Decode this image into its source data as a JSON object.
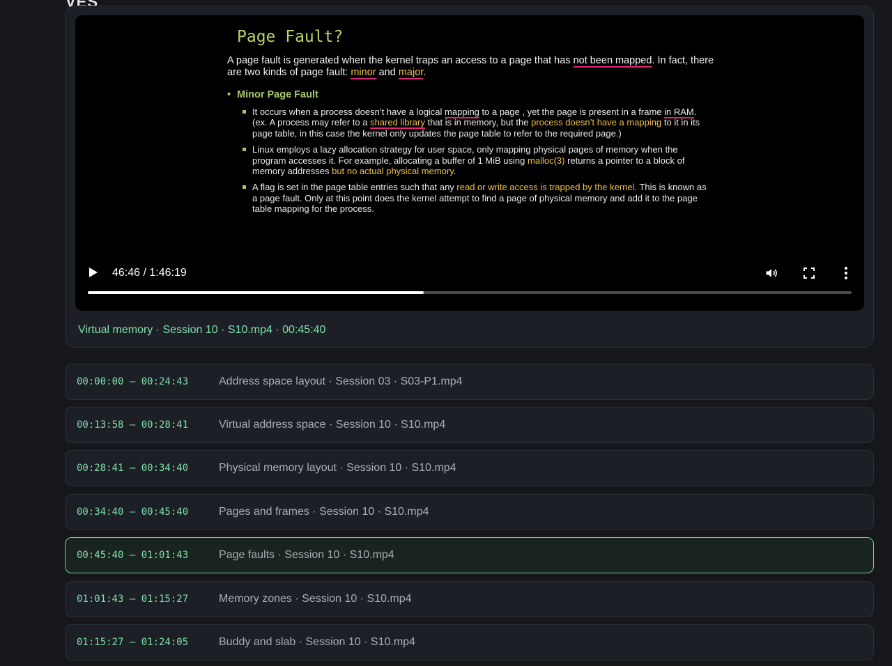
{
  "top_fragment": "VES",
  "video": {
    "slide": {
      "title": "Page Fault?",
      "intro_parts": [
        {
          "text": "A page fault is generated when the kernel traps an access to a page that has ",
          "style": ""
        },
        {
          "text": "not been mapped",
          "style": "underline"
        },
        {
          "text": ". In fact, there are two kinds of page fault: ",
          "style": ""
        },
        {
          "text": "minor",
          "style": "yellow-underline"
        },
        {
          "text": " and ",
          "style": ""
        },
        {
          "text": "major",
          "style": "yellow-underline"
        },
        {
          "text": ".",
          "style": ""
        }
      ],
      "bullet": "Minor Page Fault",
      "sub_items": [
        [
          {
            "text": "It occurs when a process doesn’t have a logical ",
            "style": ""
          },
          {
            "text": "mapping",
            "style": "underline"
          },
          {
            "text": " to a page , yet the page is present in a frame ",
            "style": ""
          },
          {
            "text": "in RAM",
            "style": "underline"
          },
          {
            "text": ". (ex. A process may refer to a ",
            "style": ""
          },
          {
            "text": "shared library",
            "style": "yellow-underline"
          },
          {
            "text": " that is in memory, but the ",
            "style": ""
          },
          {
            "text": "process doesn’t have a mapping",
            "style": "yellow"
          },
          {
            "text": " to it in its page table, in this case the kernel only updates the page table to refer to the required page.)",
            "style": ""
          }
        ],
        [
          {
            "text": "Linux employs a lazy allocation strategy for user space, only mapping physical pages of memory when the program accesses it. For example, allocating a buffer of 1 MiB using ",
            "style": ""
          },
          {
            "text": "malloc(3)",
            "style": "yellow"
          },
          {
            "text": " returns a pointer to a block of memory addresses ",
            "style": ""
          },
          {
            "text": "but no actual physical memory",
            "style": "yellow"
          },
          {
            "text": ".",
            "style": ""
          }
        ],
        [
          {
            "text": "A flag is set in the page table entries such that any ",
            "style": ""
          },
          {
            "text": "read or write access is trapped by the kernel",
            "style": "yellow"
          },
          {
            "text": ". This is known as a page fault. Only at this point does the kernel attempt to find a page of physical memory and add it to the page table mapping for the process.",
            "style": ""
          }
        ]
      ]
    },
    "time_display": "46:46 / 1:46:19",
    "progress_fraction": 0.44,
    "icons": {
      "play": "play-icon",
      "volume": "volume-icon",
      "fullscreen": "fullscreen-icon",
      "more": "more-vertical-icon"
    }
  },
  "now_playing": "Virtual memory · Session 10 · S10.mp4 · 00:45:40",
  "segments": [
    {
      "range": "00:00:00 – 00:24:43",
      "title": "Address space layout · Session 03 · S03-P1.mp4",
      "active": false
    },
    {
      "range": "00:13:58 – 00:28:41",
      "title": "Virtual address space · Session 10 · S10.mp4",
      "active": false
    },
    {
      "range": "00:28:41 – 00:34:40",
      "title": "Physical memory layout · Session 10 · S10.mp4",
      "active": false
    },
    {
      "range": "00:34:40 – 00:45:40",
      "title": "Pages and frames · Session 10 · S10.mp4",
      "active": false
    },
    {
      "range": "00:45:40 – 01:01:43",
      "title": "Page faults · Session 10 · S10.mp4",
      "active": true
    },
    {
      "range": "01:01:43 – 01:15:27",
      "title": "Memory zones · Session 10 · S10.mp4",
      "active": false
    },
    {
      "range": "01:15:27 – 01:24:05",
      "title": "Buddy and slab · Session 10 · S10.mp4",
      "active": false
    }
  ],
  "colors": {
    "accent": "#7ee0a8",
    "active_border": "#6fd3a0",
    "slide_yellow": "#f2c14e",
    "slide_green": "#a9c96b",
    "annotation_pink": "#e0247a"
  }
}
